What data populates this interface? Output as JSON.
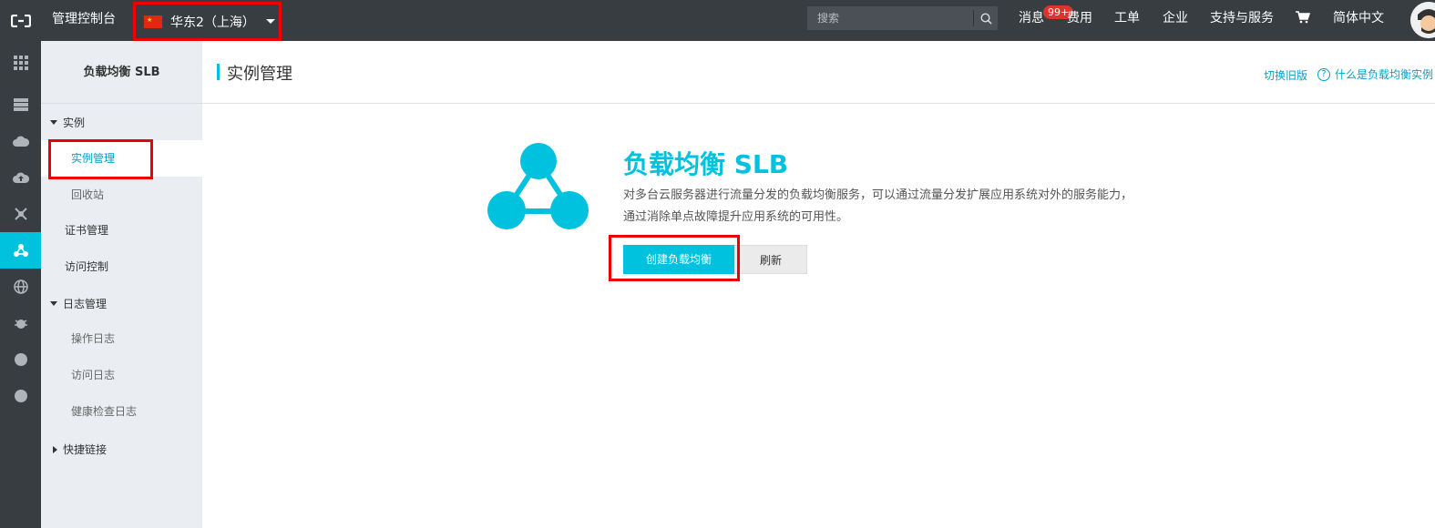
{
  "topbar": {
    "console_title": "管理控制台",
    "region": "华东2（上海）",
    "search_placeholder": "搜索",
    "nav": {
      "messages": "消息",
      "badge": "99+",
      "billing": "费用",
      "tickets": "工单",
      "enterprise": "企业",
      "support": "支持与服务",
      "language": "简体中文"
    },
    "icons": [
      "aliyun-logo-icon",
      "china-flag-icon",
      "search-icon",
      "cart-icon",
      "avatar"
    ]
  },
  "rail": {
    "icons": [
      "grid-icon",
      "server-icon",
      "cloud-icon",
      "cloud-upload-icon",
      "network-icon",
      "slb-icon",
      "globe-icon",
      "bug-icon",
      "dot-icon",
      "dot-icon"
    ]
  },
  "sidebar": {
    "title": "负载均衡 SLB",
    "group_instances": "实例",
    "instance_mgmt": "实例管理",
    "recycle_bin": "回收站",
    "cert_mgmt": "证书管理",
    "access_control": "访问控制",
    "group_logs": "日志管理",
    "operation_logs": "操作日志",
    "access_logs": "访问日志",
    "health_logs": "健康检查日志",
    "group_shortcuts": "快捷链接"
  },
  "main": {
    "page_title": "实例管理",
    "switch_old": "切换旧版",
    "help_link": "什么是负载均衡实例",
    "product_title": "负载均衡 SLB",
    "product_desc": "对多台云服务器进行流量分发的负载均衡服务，可以通过流量分发扩展应用系统对外的服务能力，通过消除单点故障提升应用系统的可用性。",
    "create_button": "创建负载均衡",
    "refresh_button": "刷新"
  },
  "colors": {
    "accent": "#00c1de",
    "topbar": "#373d41",
    "highlight": "#e00000"
  }
}
